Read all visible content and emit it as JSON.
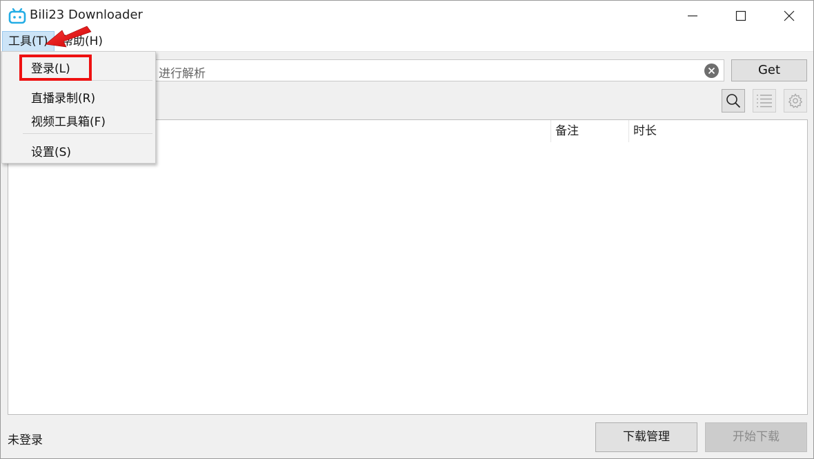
{
  "window": {
    "title": "Bili23 Downloader"
  },
  "menubar": {
    "tools": "工具(T)",
    "help": "帮助(H)"
  },
  "dropdown": {
    "items": [
      "登录(L)",
      "直播录制(R)",
      "视频工具箱(F)",
      "设置(S)"
    ]
  },
  "search": {
    "placeholder": "进行解析",
    "get_label": "Get"
  },
  "table": {
    "columns": [
      "备注",
      "时长"
    ]
  },
  "footer": {
    "status": "未登录",
    "manage_label": "下载管理",
    "start_label": "开始下载"
  },
  "colors": {
    "annotation": "#ee1111",
    "menu_highlight": "#cce4f7",
    "app_icon": "#23ade5"
  }
}
